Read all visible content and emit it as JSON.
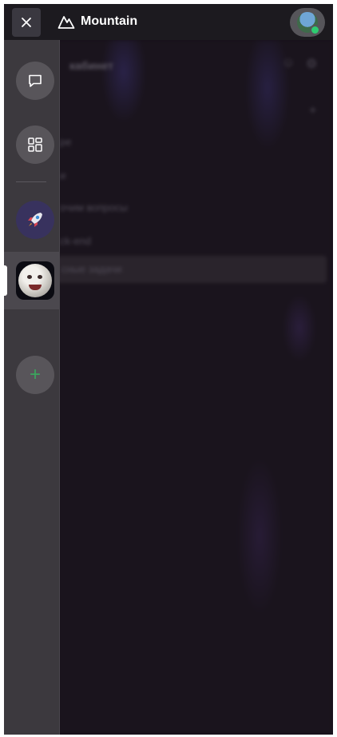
{
  "topbar": {
    "title": "Mountain",
    "close_icon": "close-icon",
    "logo_icon": "mountain-logo-icon"
  },
  "sidebar": {
    "items": [
      {
        "name": "messages",
        "icon": "chat-bubble-icon"
      },
      {
        "name": "apps",
        "icon": "grid-icon"
      },
      {
        "name": "server-rocket",
        "icon": "rocket-icon"
      },
      {
        "name": "server-moon",
        "icon": "moon-face-icon",
        "active": true
      },
      {
        "name": "add-server",
        "icon": "plus-icon"
      }
    ]
  },
  "background": {
    "title": "кабинет",
    "items": [
      "ре",
      "и",
      "очим вопросы",
      "ck-end",
      "сные задачи"
    ]
  },
  "colors": {
    "online": "#2ecc71",
    "add_accent": "#3ba55d"
  }
}
